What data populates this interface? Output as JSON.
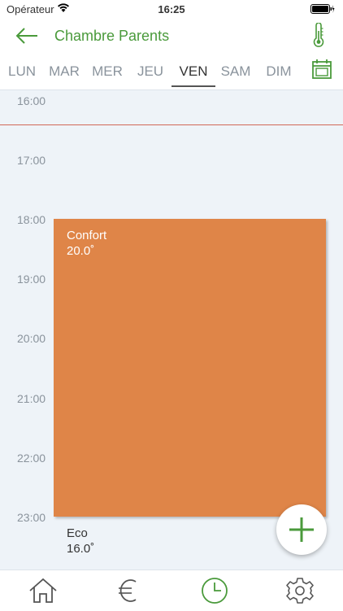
{
  "status": {
    "carrier": "Opérateur",
    "time": "16:25"
  },
  "header": {
    "title": "Chambre Parents"
  },
  "days": [
    "LUN",
    "MAR",
    "MER",
    "JEU",
    "VEN",
    "SAM",
    "DIM"
  ],
  "active_day": "VEN",
  "hours": [
    "16:00",
    "17:00",
    "18:00",
    "19:00",
    "20:00",
    "21:00",
    "22:00",
    "23:00"
  ],
  "comfort_block": {
    "name": "Confort",
    "temp": "20.0˚",
    "start": "18:00",
    "end": "23:00"
  },
  "eco_block": {
    "name": "Eco",
    "temp": "16.0˚"
  },
  "colors": {
    "accent": "#4a9a3b",
    "comfort": "#df8548",
    "now_line": "#d06858"
  },
  "icons": {
    "back": "arrow-left-icon",
    "thermometer": "thermometer-icon",
    "calendar": "calendar-icon",
    "add": "plus-icon",
    "tabs": [
      "home-icon",
      "euro-icon",
      "clock-icon",
      "gear-icon"
    ]
  }
}
